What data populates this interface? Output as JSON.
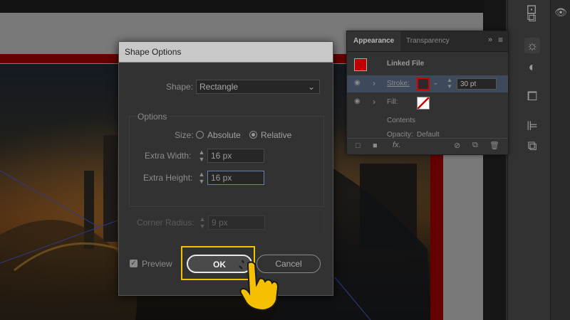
{
  "dialog": {
    "title": "Shape Options",
    "shape": {
      "label": "Shape:",
      "value": "Rectangle"
    },
    "options": {
      "section_label": "Options",
      "size_label": "Size:",
      "size_choices": [
        {
          "label": "Absolute",
          "selected": false
        },
        {
          "label": "Relative",
          "selected": true
        }
      ],
      "extra_width": {
        "label": "Extra Width:",
        "value": "16 px"
      },
      "extra_height": {
        "label": "Extra Height:",
        "value": "16 px"
      }
    },
    "corner_radius": {
      "label": "Corner Radius:",
      "value": "9 px"
    },
    "preview": {
      "label": "Preview",
      "checked": true
    },
    "ok_label": "OK",
    "cancel_label": "Cancel"
  },
  "appearance_panel": {
    "tabs": [
      "Appearance",
      "Transparency"
    ],
    "header_label": "Linked File",
    "stroke": {
      "label": "Stroke:",
      "value": "30 pt",
      "color": "#d40000"
    },
    "fill": {
      "label": "Fill:"
    },
    "contents_label": "Contents",
    "opacity": {
      "label": "Opacity:",
      "value": "Default"
    }
  },
  "colors": {
    "highlight": "#f2c200",
    "red_frame": "#c00000",
    "panel_bg": "#323232"
  },
  "icons": [
    "eye-icon",
    "chevron-right-icon",
    "collapse-icon",
    "menu-icon",
    "square-icon",
    "fx-icon",
    "clear-icon",
    "duplicate-icon",
    "trash-icon",
    "pointer-hand-icon"
  ]
}
